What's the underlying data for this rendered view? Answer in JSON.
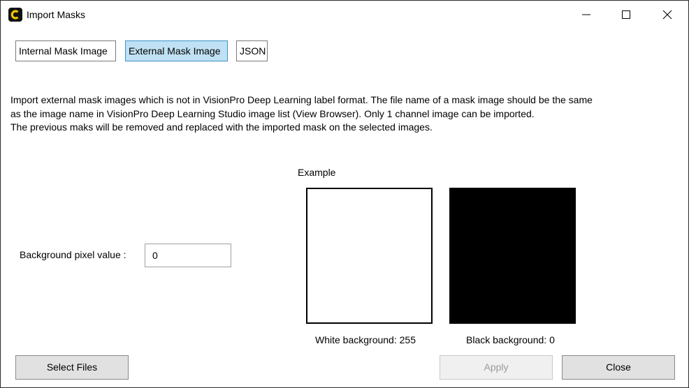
{
  "window": {
    "title": "Import Masks",
    "icon": "app-logo-icon",
    "controls": [
      "minimize-icon",
      "maximize-icon",
      "close-icon"
    ]
  },
  "tabs": [
    {
      "label": "Internal Mask Image",
      "active": false
    },
    {
      "label": "External Mask Image",
      "active": true
    },
    {
      "label": "JSON",
      "active": false
    }
  ],
  "description": {
    "line1": "Import external mask images which is not in VisionPro Deep Learning label format. The file name of a mask image should be the same as the image name in VisionPro Deep Learning Studio image list (View Browser). Only 1 channel image can be imported.",
    "line2": "The previous maks will be removed and replaced with the imported mask on the selected images."
  },
  "background": {
    "label": "Background pixel value :",
    "value": "0"
  },
  "example": {
    "label": "Example",
    "white_caption": "White background: 255",
    "black_caption": "Black background: 0"
  },
  "buttons": {
    "select_files": "Select Files",
    "apply": "Apply",
    "close": "Close"
  },
  "colors": {
    "active_tab": "#bfe1f3",
    "active_tab_border": "#3b93c8",
    "button": "#e1e1e1",
    "app_icon_yellow": "#f5c400"
  }
}
